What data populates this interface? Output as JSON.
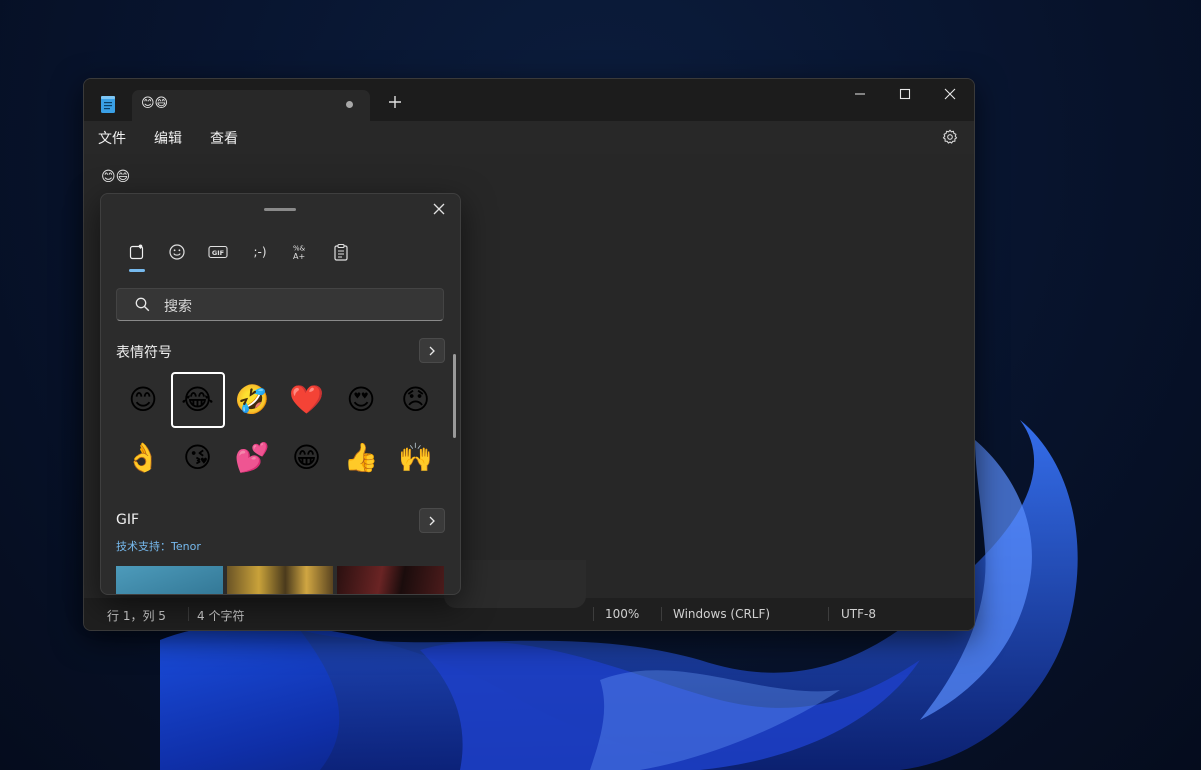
{
  "window": {
    "tab_title": "😊😄",
    "new_tab_label": "+"
  },
  "menu": {
    "file": "文件",
    "edit": "编辑",
    "view": "查看"
  },
  "editor": {
    "content": "😊😄"
  },
  "status": {
    "position": "行 1，列 5",
    "char_count": "4 个字符",
    "zoom": "100%",
    "line_ending": "Windows (CRLF)",
    "encoding": "UTF-8"
  },
  "emoji_panel": {
    "categories": [
      "favorites-icon",
      "emoji-icon",
      "gif-icon",
      "kaomoji-icon",
      "symbols-icon",
      "clipboard-icon"
    ],
    "search_placeholder": "搜索",
    "emoji_section_title": "表情符号",
    "emojis": [
      "😊",
      "😂",
      "🤣",
      "❤️",
      "😍",
      "😞",
      "👌",
      "😘",
      "💕",
      "😁",
      "👍",
      "🙌"
    ],
    "selected_index": 1,
    "gif_section_title": "GIF",
    "gif_credit": "技术支持：Tenor"
  },
  "colors": {
    "accent": "#76b9ed",
    "window_bg": "#202020",
    "panel_bg": "#2c2c2c"
  }
}
